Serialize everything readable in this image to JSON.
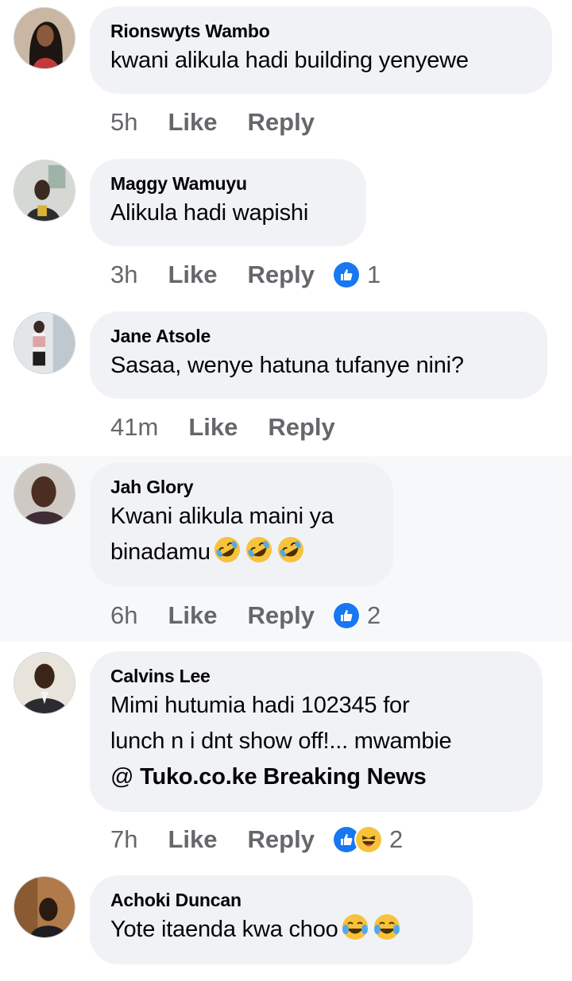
{
  "comments": [
    {
      "author": "Rionswyts Wambo",
      "text": "kwani alikula hadi building yenyewe",
      "time": "5h",
      "like_label": "Like",
      "reply_label": "Reply"
    },
    {
      "author": "Maggy Wamuyu",
      "text": "Alikula hadi wapishi",
      "time": "3h",
      "like_label": "Like",
      "reply_label": "Reply",
      "reaction_count": "1",
      "reaction_icons": [
        "like-icon"
      ]
    },
    {
      "author": "Jane Atsole",
      "text": "Sasaa, wenye hatuna tufanye nini?",
      "time": "41m",
      "like_label": "Like",
      "reply_label": "Reply"
    },
    {
      "author": "Jah Glory",
      "text_line1": "Kwani alikula maini ya",
      "text_line2": "binadamu",
      "emojis": [
        "rolling-on-floor-laughing",
        "rolling-on-floor-laughing",
        "rolling-on-floor-laughing"
      ],
      "time": "6h",
      "like_label": "Like",
      "reply_label": "Reply",
      "reaction_count": "2",
      "reaction_icons": [
        "like-icon"
      ]
    },
    {
      "author": "Calvins Lee",
      "text_line1": "Mimi hutumia hadi 102345 for",
      "text_line2": "lunch n i dnt show off!... mwambie",
      "mention_prefix": "@ ",
      "mention": "Tuko.co.ke Breaking News",
      "time": "7h",
      "like_label": "Like",
      "reply_label": "Reply",
      "reaction_count": "2",
      "reaction_icons": [
        "like-icon",
        "haha-icon"
      ]
    },
    {
      "author": "Achoki Duncan",
      "text": "Yote itaenda kwa choo",
      "emojis": [
        "face-with-tears-of-joy",
        "face-with-tears-of-joy"
      ]
    }
  ],
  "colors": {
    "bubble": "#f0f2f5",
    "meta_text": "#65676b",
    "like_blue": "#1877f2",
    "haha_yellow": "#f7c23c"
  }
}
